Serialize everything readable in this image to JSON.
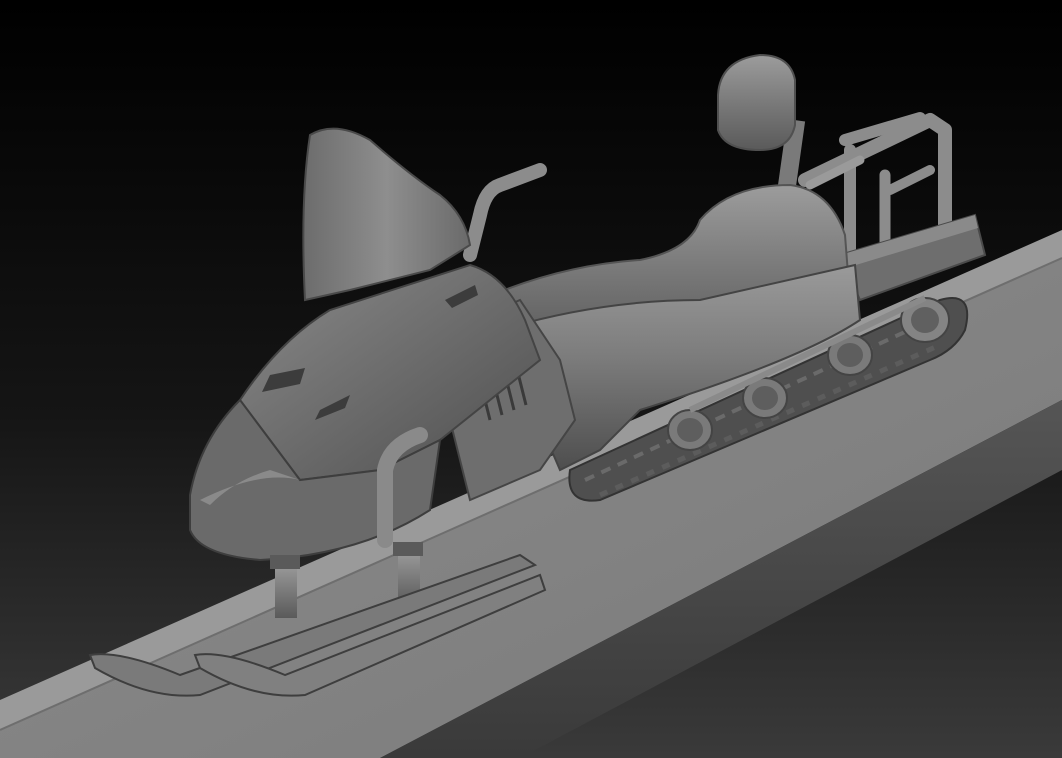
{
  "scene": {
    "subject": "snowmobile",
    "colors": {
      "background_top": "#000000",
      "background_bottom": "#3a3a3a",
      "clay": "#7a7a7a",
      "clay_light": "#a6a6a6",
      "clay_dark": "#3e3e3e",
      "ramp_top": "#8a8a8a",
      "ramp_side": "#4a4a4a"
    }
  }
}
